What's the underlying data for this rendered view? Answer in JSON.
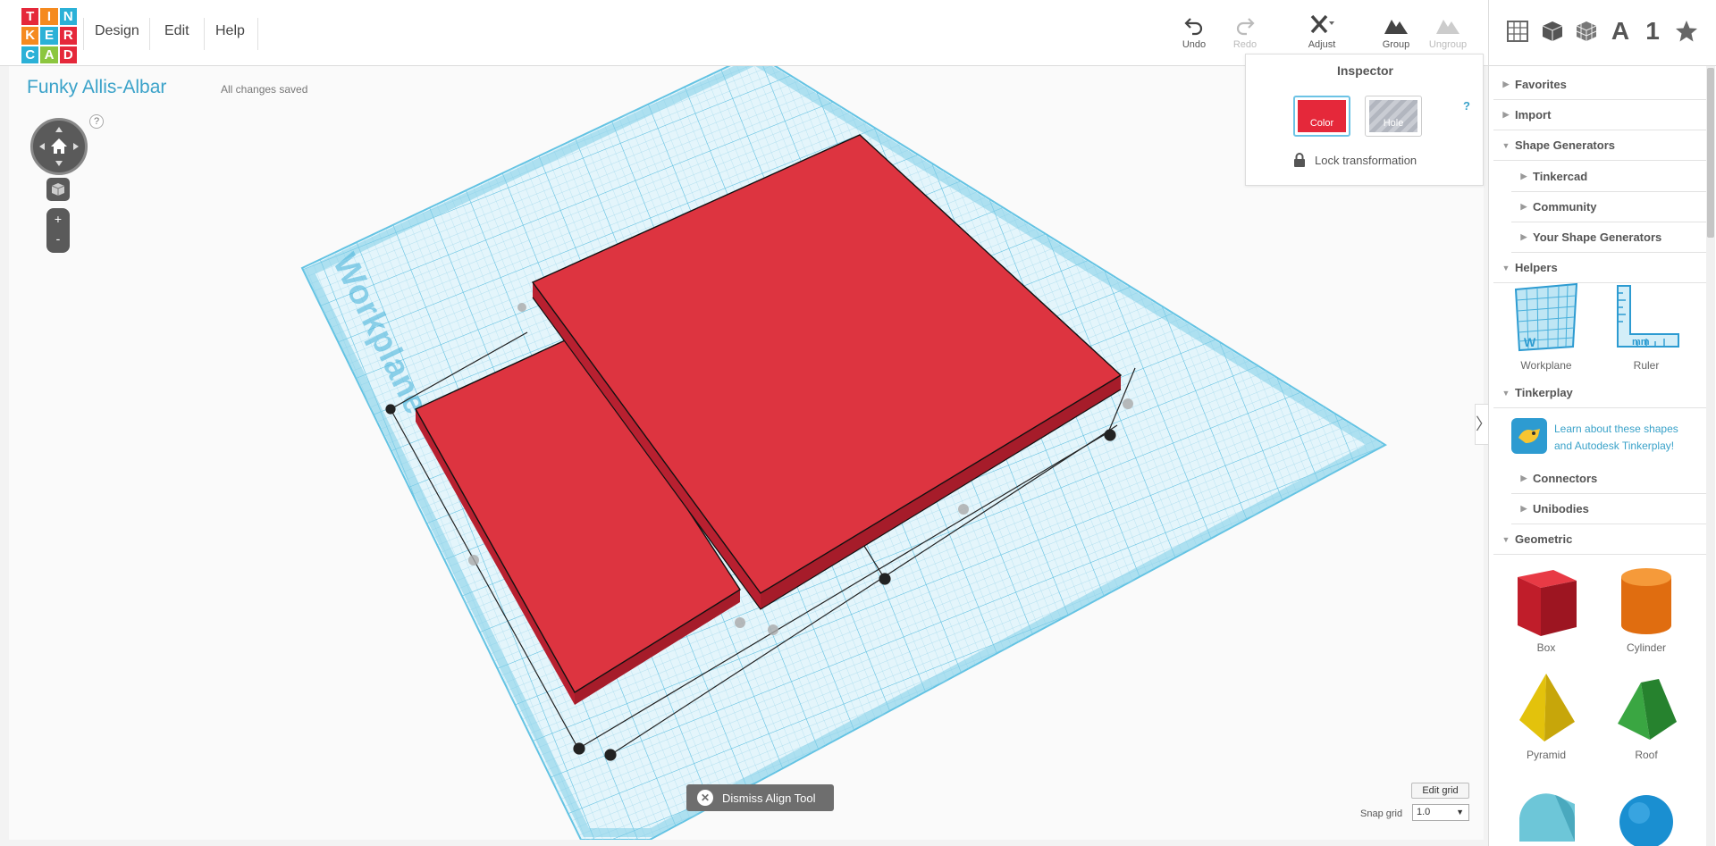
{
  "logo": {
    "letters": [
      "T",
      "I",
      "N",
      "K",
      "E",
      "R",
      "C",
      "A",
      "D"
    ],
    "colors": [
      "#e5283a",
      "#f58a1f",
      "#2bb1d7",
      "#f58a1f",
      "#2bb1d7",
      "#e5283a",
      "#2bb1d7",
      "#8cc63f",
      "#e5283a"
    ]
  },
  "menu": {
    "design": "Design",
    "edit": "Edit",
    "help": "Help"
  },
  "toolbar": {
    "undo": "Undo",
    "redo": "Redo",
    "adjust": "Adjust",
    "group": "Group",
    "ungroup": "Ungroup"
  },
  "right_tools": {
    "text_tool": "A",
    "number_tool": "1"
  },
  "design": {
    "title": "Funky Allis-Albar",
    "save_status": "All changes saved"
  },
  "nav": {
    "help": "?",
    "zoom_in": "+",
    "zoom_out": "-"
  },
  "inspector": {
    "title": "Inspector",
    "color_label": "Color",
    "hole_label": "Hole",
    "help": "?",
    "lock_label": "Lock transformation",
    "color": "#e5283a"
  },
  "workplane": {
    "label": "Workplane"
  },
  "sidebar": {
    "collapse_tab": "〉",
    "favorites": "Favorites",
    "import": "Import",
    "shape_generators": "Shape Generators",
    "tinkercad": "Tinkercad",
    "community": "Community",
    "your_shape_generators": "Your Shape Generators",
    "helpers": "Helpers",
    "workplane": "Workplane",
    "ruler": "Ruler",
    "tinkerplay": "Tinkerplay",
    "tinkerplay_link": "Learn about these shapes and Autodesk Tinkerplay!",
    "connectors": "Connectors",
    "unibodies": "Unibodies",
    "geometric": "Geometric",
    "box": "Box",
    "cylinder": "Cylinder",
    "pyramid": "Pyramid",
    "roof": "Roof"
  },
  "bottom": {
    "dismiss_align": "Dismiss Align Tool",
    "dismiss_x": "✕",
    "edit_grid": "Edit grid",
    "snap_grid_label": "Snap grid",
    "snap_grid_value": "1.0"
  }
}
